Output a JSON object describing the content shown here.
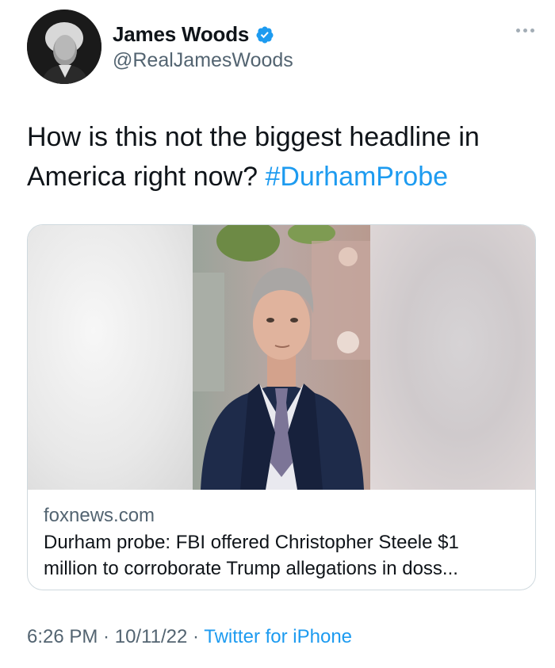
{
  "author": {
    "display_name": "James Woods",
    "handle": "@RealJamesWoods",
    "verified": true
  },
  "tweet": {
    "text": "How is this not the biggest headline in America right now? ",
    "hashtag": "#DurhamProbe"
  },
  "link_card": {
    "domain": "foxnews.com",
    "title_line1": "Durham probe: FBI offered Christopher Steele $1",
    "title_line2": "million to corroborate Trump allegations in doss..."
  },
  "meta": {
    "time": "6:26 PM",
    "separator": " · ",
    "date": "10/11/22",
    "source": "Twitter for iPhone"
  },
  "colors": {
    "link": "#1d9bf0",
    "secondary_text": "#536471",
    "border": "#cfd9de"
  },
  "icons": [
    "verified-badge-icon",
    "more-options-icon"
  ]
}
